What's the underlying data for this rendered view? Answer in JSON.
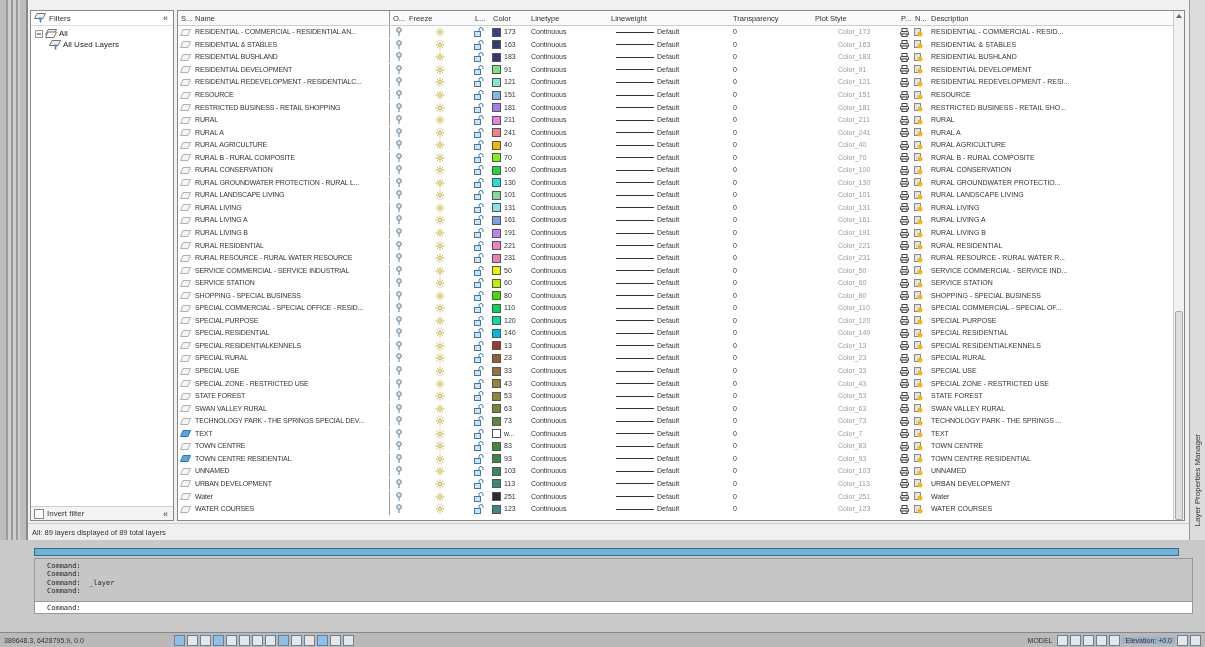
{
  "filters": {
    "title": "Filters",
    "collapse_top": "«",
    "collapse_bottom": "«",
    "tree": [
      {
        "label": "All",
        "expanded": true,
        "children": [
          {
            "label": "All Used Layers"
          }
        ]
      }
    ],
    "invert_filter": {
      "label": "Invert filter",
      "checked": false
    }
  },
  "table": {
    "columns": [
      "S...",
      "Name",
      "O...",
      "Freeze",
      "L...",
      "Color",
      "Linetype",
      "Lineweight",
      "Transparency",
      "Plot Style",
      "P...",
      "N...",
      "Description"
    ],
    "rows": [
      {
        "name": "RESIDENTIAL - COMMERCIAL - RESIDENTIAL AN...",
        "current": false,
        "color_number": "173",
        "color": "#3a3f8f",
        "linetype": "Continuous",
        "lineweight": "Default",
        "transparency": "0",
        "plot_style": "Color_173",
        "description": "RESIDENTIAL - COMMERCIAL - RESID..."
      },
      {
        "name": "RESIDENTIAL & STABLES",
        "current": false,
        "color_number": "163",
        "color": "#2e3a7a",
        "linetype": "Continuous",
        "lineweight": "Default",
        "transparency": "0",
        "plot_style": "Color_163",
        "description": "RESIDENTIAL & STABLES"
      },
      {
        "name": "RESIDENTIAL BUSHLAND",
        "current": false,
        "color_number": "183",
        "color": "#3c2f7f",
        "linetype": "Continuous",
        "lineweight": "Default",
        "transparency": "0",
        "plot_style": "Color_183",
        "description": "RESIDENTIAL BUSHLAND"
      },
      {
        "name": "RESIDENTIAL DEVELOPMENT",
        "current": false,
        "color_number": "91",
        "color": "#7fe07f",
        "linetype": "Continuous",
        "lineweight": "Default",
        "transparency": "0",
        "plot_style": "Color_91",
        "description": "RESIDENTIAL DEVELOPMENT"
      },
      {
        "name": "RESIDENTIAL REDEVELOPMENT - RESIDENTIALC...",
        "current": false,
        "color_number": "121",
        "color": "#7fe8c8",
        "linetype": "Continuous",
        "lineweight": "Default",
        "transparency": "0",
        "plot_style": "Color_121",
        "description": "RESIDENTIAL REDEVELOPMENT - RESI..."
      },
      {
        "name": "RESOURCE",
        "current": false,
        "color_number": "151",
        "color": "#7fb5f0",
        "linetype": "Continuous",
        "lineweight": "Default",
        "transparency": "0",
        "plot_style": "Color_151",
        "description": "RESOURCE"
      },
      {
        "name": "RESTRICTED BUSINESS - RETAIL SHOPPING",
        "current": false,
        "color_number": "181",
        "color": "#9f7ff0",
        "linetype": "Continuous",
        "lineweight": "Default",
        "transparency": "0",
        "plot_style": "Color_181",
        "description": "RESTRICTED BUSINESS - RETAIL SHO..."
      },
      {
        "name": "RURAL",
        "current": false,
        "color_number": "211",
        "color": "#e67fe6",
        "linetype": "Continuous",
        "lineweight": "Default",
        "transparency": "0",
        "plot_style": "Color_211",
        "description": "RURAL"
      },
      {
        "name": "RURAL A",
        "current": false,
        "color_number": "241",
        "color": "#f07f8f",
        "linetype": "Continuous",
        "lineweight": "Default",
        "transparency": "0",
        "plot_style": "Color_241",
        "description": "RURAL A"
      },
      {
        "name": "RURAL AGRICULTURE",
        "current": false,
        "color_number": "40",
        "color": "#f5b400",
        "linetype": "Continuous",
        "lineweight": "Default",
        "transparency": "0",
        "plot_style": "Color_40",
        "description": "RURAL AGRICULTURE"
      },
      {
        "name": "RURAL B - RURAL COMPOSITE",
        "current": false,
        "color_number": "70",
        "color": "#7fef1f",
        "linetype": "Continuous",
        "lineweight": "Default",
        "transparency": "0",
        "plot_style": "Color_70",
        "description": "RURAL B - RURAL COMPOSITE"
      },
      {
        "name": "RURAL CONSERVATION",
        "current": false,
        "color_number": "100",
        "color": "#1fd83a",
        "linetype": "Continuous",
        "lineweight": "Default",
        "transparency": "0",
        "plot_style": "Color_100",
        "description": "RURAL CONSERVATION"
      },
      {
        "name": "RURAL GROUNDWATER PROTECTION - RURAL L...",
        "current": false,
        "color_number": "130",
        "color": "#1fe0e0",
        "linetype": "Continuous",
        "lineweight": "Default",
        "transparency": "0",
        "plot_style": "Color_130",
        "description": "RURAL GROUNDWATER PROTECTIO..."
      },
      {
        "name": "RURAL LANDSCAPE LIVING",
        "current": false,
        "color_number": "101",
        "color": "#7fdc9a",
        "linetype": "Continuous",
        "lineweight": "Default",
        "transparency": "0",
        "plot_style": "Color_101",
        "description": "RURAL LANDSCAPE LIVING"
      },
      {
        "name": "RURAL LIVING",
        "current": false,
        "color_number": "131",
        "color": "#7fe6e6",
        "linetype": "Continuous",
        "lineweight": "Default",
        "transparency": "0",
        "plot_style": "Color_131",
        "description": "RURAL LIVING"
      },
      {
        "name": "RURAL LIVING A",
        "current": false,
        "color_number": "161",
        "color": "#7f9cef",
        "linetype": "Continuous",
        "lineweight": "Default",
        "transparency": "0",
        "plot_style": "Color_161",
        "description": "RURAL LIVING A"
      },
      {
        "name": "RURAL LIVING B",
        "current": false,
        "color_number": "191",
        "color": "#c07fef",
        "linetype": "Continuous",
        "lineweight": "Default",
        "transparency": "0",
        "plot_style": "Color_191",
        "description": "RURAL LIVING B"
      },
      {
        "name": "RURAL RESIDENTIAL",
        "current": false,
        "color_number": "221",
        "color": "#ee7fce",
        "linetype": "Continuous",
        "lineweight": "Default",
        "transparency": "0",
        "plot_style": "Color_221",
        "description": "RURAL RESIDENTIAL"
      },
      {
        "name": "RURAL RESOURCE - RURAL WATER RESOURCE",
        "current": false,
        "color_number": "231",
        "color": "#ef7fae",
        "linetype": "Continuous",
        "lineweight": "Default",
        "transparency": "0",
        "plot_style": "Color_231",
        "description": "RURAL RESOURCE - RURAL WATER R..."
      },
      {
        "name": "SERVICE COMMERCIAL - SERVICE INDUSTRIAL",
        "current": false,
        "color_number": "50",
        "color": "#f0f000",
        "linetype": "Continuous",
        "lineweight": "Default",
        "transparency": "0",
        "plot_style": "Color_50",
        "description": "SERVICE COMMERCIAL - SERVICE IND..."
      },
      {
        "name": "SERVICE STATION",
        "current": false,
        "color_number": "60",
        "color": "#bfef00",
        "linetype": "Continuous",
        "lineweight": "Default",
        "transparency": "0",
        "plot_style": "Color_60",
        "description": "SERVICE STATION"
      },
      {
        "name": "SHOPPING - SPECIAL BUSINESS",
        "current": false,
        "color_number": "80",
        "color": "#3fdf00",
        "linetype": "Continuous",
        "lineweight": "Default",
        "transparency": "0",
        "plot_style": "Color_80",
        "description": "SHOPPING - SPECIAL BUSINESS"
      },
      {
        "name": "SPECIAL COMMERCIAL - SPECIAL OFFICE - RESID...",
        "current": false,
        "color_number": "110",
        "color": "#00d84f",
        "linetype": "Continuous",
        "lineweight": "Default",
        "transparency": "0",
        "plot_style": "Color_110",
        "description": "SPECIAL COMMERCIAL - SPECIAL OF..."
      },
      {
        "name": "SPECIAL PURPOSE",
        "current": false,
        "color_number": "120",
        "color": "#00dfa0",
        "linetype": "Continuous",
        "lineweight": "Default",
        "transparency": "0",
        "plot_style": "Color_120",
        "description": "SPECIAL PURPOSE"
      },
      {
        "name": "SPECIAL RESIDENTIAL",
        "current": false,
        "color_number": "140",
        "color": "#00b8e8",
        "linetype": "Continuous",
        "lineweight": "Default",
        "transparency": "0",
        "plot_style": "Color_140",
        "description": "SPECIAL RESIDENTIAL"
      },
      {
        "name": "SPECIAL RESIDENTIALKENNELS",
        "current": false,
        "color_number": "13",
        "color": "#9a3838",
        "linetype": "Continuous",
        "lineweight": "Default",
        "transparency": "0",
        "plot_style": "Color_13",
        "description": "SPECIAL RESIDENTIALKENNELS"
      },
      {
        "name": "SPECIAL RURAL",
        "current": false,
        "color_number": "23",
        "color": "#9a5a38",
        "linetype": "Continuous",
        "lineweight": "Default",
        "transparency": "0",
        "plot_style": "Color_23",
        "description": "SPECIAL RURAL"
      },
      {
        "name": "SPECIAL USE",
        "current": false,
        "color_number": "33",
        "color": "#9a7238",
        "linetype": "Continuous",
        "lineweight": "Default",
        "transparency": "0",
        "plot_style": "Color_33",
        "description": "SPECIAL USE"
      },
      {
        "name": "SPECIAL ZONE - RESTRICTED USE",
        "current": false,
        "color_number": "43",
        "color": "#9a8238",
        "linetype": "Continuous",
        "lineweight": "Default",
        "transparency": "0",
        "plot_style": "Color_43",
        "description": "SPECIAL ZONE - RESTRICTED USE"
      },
      {
        "name": "STATE FOREST",
        "current": false,
        "color_number": "53",
        "color": "#8a8a38",
        "linetype": "Continuous",
        "lineweight": "Default",
        "transparency": "0",
        "plot_style": "Color_53",
        "description": "STATE FOREST"
      },
      {
        "name": "SWAN VALLEY RURAL",
        "current": false,
        "color_number": "63",
        "color": "#728a38",
        "linetype": "Continuous",
        "lineweight": "Default",
        "transparency": "0",
        "plot_style": "Color_63",
        "description": "SWAN VALLEY RURAL"
      },
      {
        "name": "TECHNOLOGY PARK - THE SPRINGS SPECIAL DEV...",
        "current": false,
        "color_number": "73",
        "color": "#5a8a38",
        "linetype": "Continuous",
        "lineweight": "Default",
        "transparency": "0",
        "plot_style": "Color_73",
        "description": "TECHNOLOGY PARK - THE SPRINGS ..."
      },
      {
        "name": "TEXT",
        "current": true,
        "color_number": "w...",
        "color": "#ffffff",
        "linetype": "Continuous",
        "lineweight": "Default",
        "transparency": "0",
        "plot_style": "Color_7",
        "description": "TEXT"
      },
      {
        "name": "TOWN CENTRE",
        "current": false,
        "color_number": "83",
        "color": "#3f8a38",
        "linetype": "Continuous",
        "lineweight": "Default",
        "transparency": "0",
        "plot_style": "Color_83",
        "description": "TOWN CENTRE"
      },
      {
        "name": "TOWN CENTRE RESIDENTIAL",
        "current": true,
        "color_number": "93",
        "color": "#388a48",
        "linetype": "Continuous",
        "lineweight": "Default",
        "transparency": "0",
        "plot_style": "Color_93",
        "description": "TOWN CENTRE RESIDENTIAL"
      },
      {
        "name": "UNNAMED",
        "current": false,
        "color_number": "103",
        "color": "#388a5e",
        "linetype": "Continuous",
        "lineweight": "Default",
        "transparency": "0",
        "plot_style": "Color_103",
        "description": "UNNAMED"
      },
      {
        "name": "URBAN DEVELOPMENT",
        "current": false,
        "color_number": "113",
        "color": "#388a72",
        "linetype": "Continuous",
        "lineweight": "Default",
        "transparency": "0",
        "plot_style": "Color_113",
        "description": "URBAN DEVELOPMENT"
      },
      {
        "name": "Water",
        "current": false,
        "color_number": "251",
        "color": "#2e2e2e",
        "linetype": "Continuous",
        "lineweight": "Default",
        "transparency": "0",
        "plot_style": "Color_251",
        "description": "Water"
      },
      {
        "name": "WATER COURSES",
        "current": false,
        "color_number": "123",
        "color": "#388a84",
        "linetype": "Continuous",
        "lineweight": "Default",
        "transparency": "0",
        "plot_style": "Color_123",
        "description": "WATER COURSES"
      }
    ]
  },
  "side_title": "Layer Properties Manager",
  "status_text": "All: 89 layers displayed of 89 total layers",
  "command_history": [
    "Command:",
    "Command:",
    "Command:  _layer",
    "Command:"
  ],
  "command_input": "Command:",
  "status_bar": {
    "coordinates": "389648.3, 6428795.9, 0.0",
    "model": "MODEL",
    "elevation": "Elevation: +0.0"
  }
}
